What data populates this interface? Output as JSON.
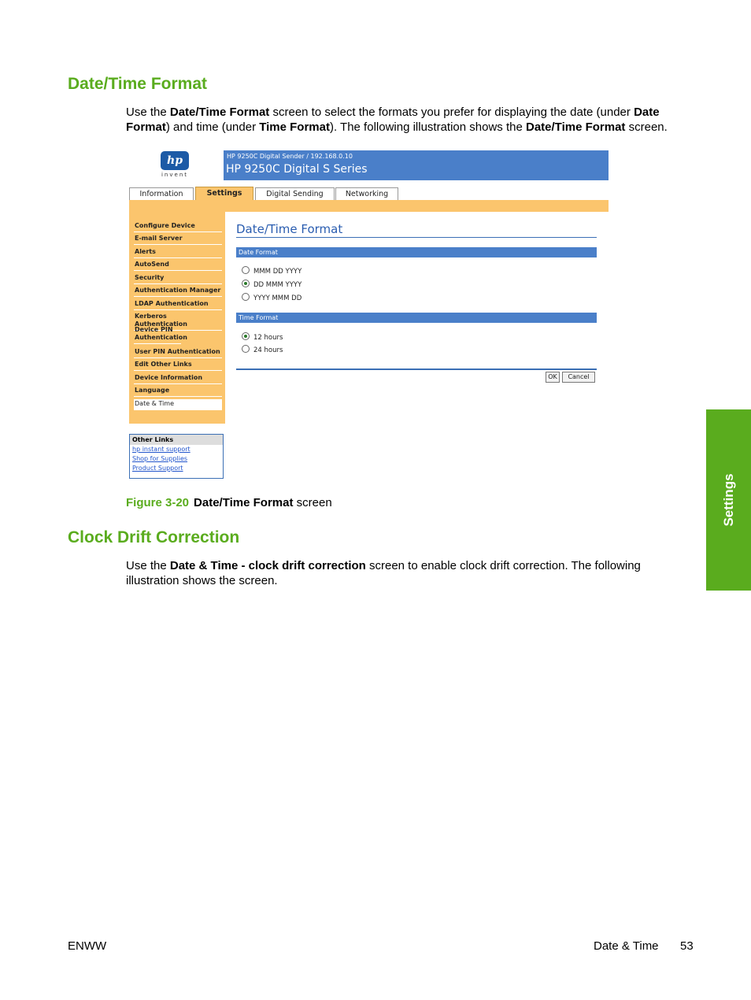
{
  "section1": {
    "heading": "Date/Time Format",
    "paragraph": [
      {
        "t": "Use the ",
        "b": false
      },
      {
        "t": "Date/Time Format",
        "b": true
      },
      {
        "t": " screen to select the formats you prefer for displaying the date (under ",
        "b": false
      },
      {
        "t": "Date Format",
        "b": true
      },
      {
        "t": ") and time (under ",
        "b": false
      },
      {
        "t": "Time Format",
        "b": true
      },
      {
        "t": "). The following illustration shows the ",
        "b": false
      },
      {
        "t": "Date/Time Format",
        "b": true
      },
      {
        "t": " screen.",
        "b": false
      }
    ]
  },
  "screenshot": {
    "logo_text": "hp",
    "logo_sub": "invent",
    "banner_sub": "HP 9250C Digital Sender / 192.168.0.10",
    "banner_main": "HP 9250C Digital S Series",
    "tabs": [
      "Information",
      "Settings",
      "Digital Sending",
      "Networking"
    ],
    "active_tab": "Settings",
    "nav": [
      "Configure Device",
      "E-mail Server",
      "Alerts",
      "AutoSend",
      "Security",
      "Authentication Manager",
      "LDAP Authentication",
      "Kerberos Authentication",
      "Device PIN Authentication",
      "User PIN Authentication",
      "Edit Other Links",
      "Device Information",
      "Language",
      "Date & Time"
    ],
    "active_nav": "Date & Time",
    "other_links": {
      "header": "Other Links",
      "links": [
        "hp instant support",
        "Shop for Supplies",
        "Product Support"
      ]
    },
    "page_title": "Date/Time Format",
    "date_section": {
      "label": "Date Format",
      "options": [
        "MMM DD YYYY",
        "DD MMM YYYY",
        "YYYY MMM DD"
      ],
      "selected": "DD MMM YYYY"
    },
    "time_section": {
      "label": "Time Format",
      "options": [
        "12 hours",
        "24 hours"
      ],
      "selected": "12 hours"
    },
    "buttons": {
      "ok": "OK",
      "cancel": "Cancel"
    }
  },
  "caption": {
    "figure": "Figure 3-20",
    "bold": "Date/Time Format",
    "rest": " screen"
  },
  "section2": {
    "heading": "Clock Drift Correction",
    "paragraph": [
      {
        "t": "Use the ",
        "b": false
      },
      {
        "t": "Date & Time - clock drift correction",
        "b": true
      },
      {
        "t": " screen to enable clock drift correction. The following illustration shows the screen.",
        "b": false
      }
    ]
  },
  "side_tab": "Settings",
  "footer": {
    "left": "ENWW",
    "right_label": "Date & Time",
    "page": "53"
  }
}
